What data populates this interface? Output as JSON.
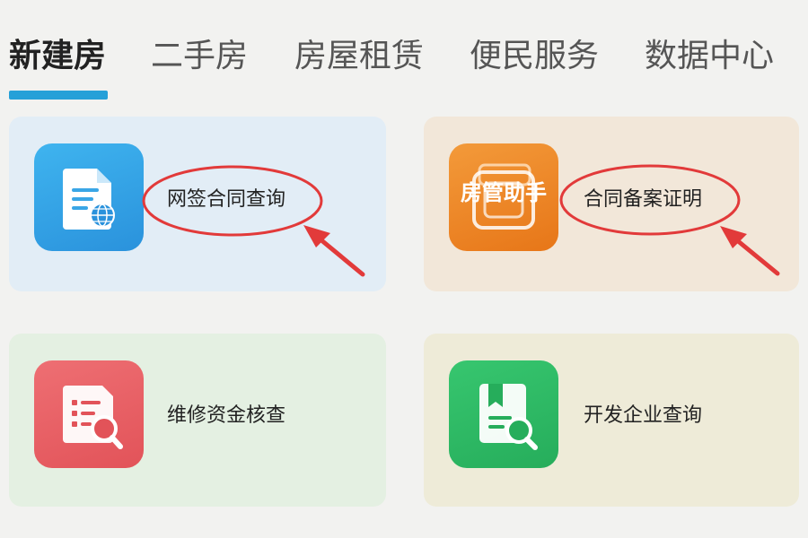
{
  "tabs": [
    {
      "label": "新建房",
      "active": true
    },
    {
      "label": "二手房",
      "active": false
    },
    {
      "label": "房屋租赁",
      "active": false
    },
    {
      "label": "便民服务",
      "active": false
    },
    {
      "label": "数据中心",
      "active": false
    }
  ],
  "colors": {
    "accent": "#25a0d8",
    "annotation_red": "#e23a3a"
  },
  "cards": [
    {
      "label": "网签合同查询",
      "icon": "contract-globe-icon",
      "annotated": true
    },
    {
      "label": "合同备案证明",
      "icon": "house-manager-icon",
      "icon_overlay_text": "房管助手",
      "annotated": true
    },
    {
      "label": "维修资金核查",
      "icon": "document-search-icon",
      "annotated": false
    },
    {
      "label": "开发企业查询",
      "icon": "bookmark-search-icon",
      "annotated": false
    }
  ]
}
